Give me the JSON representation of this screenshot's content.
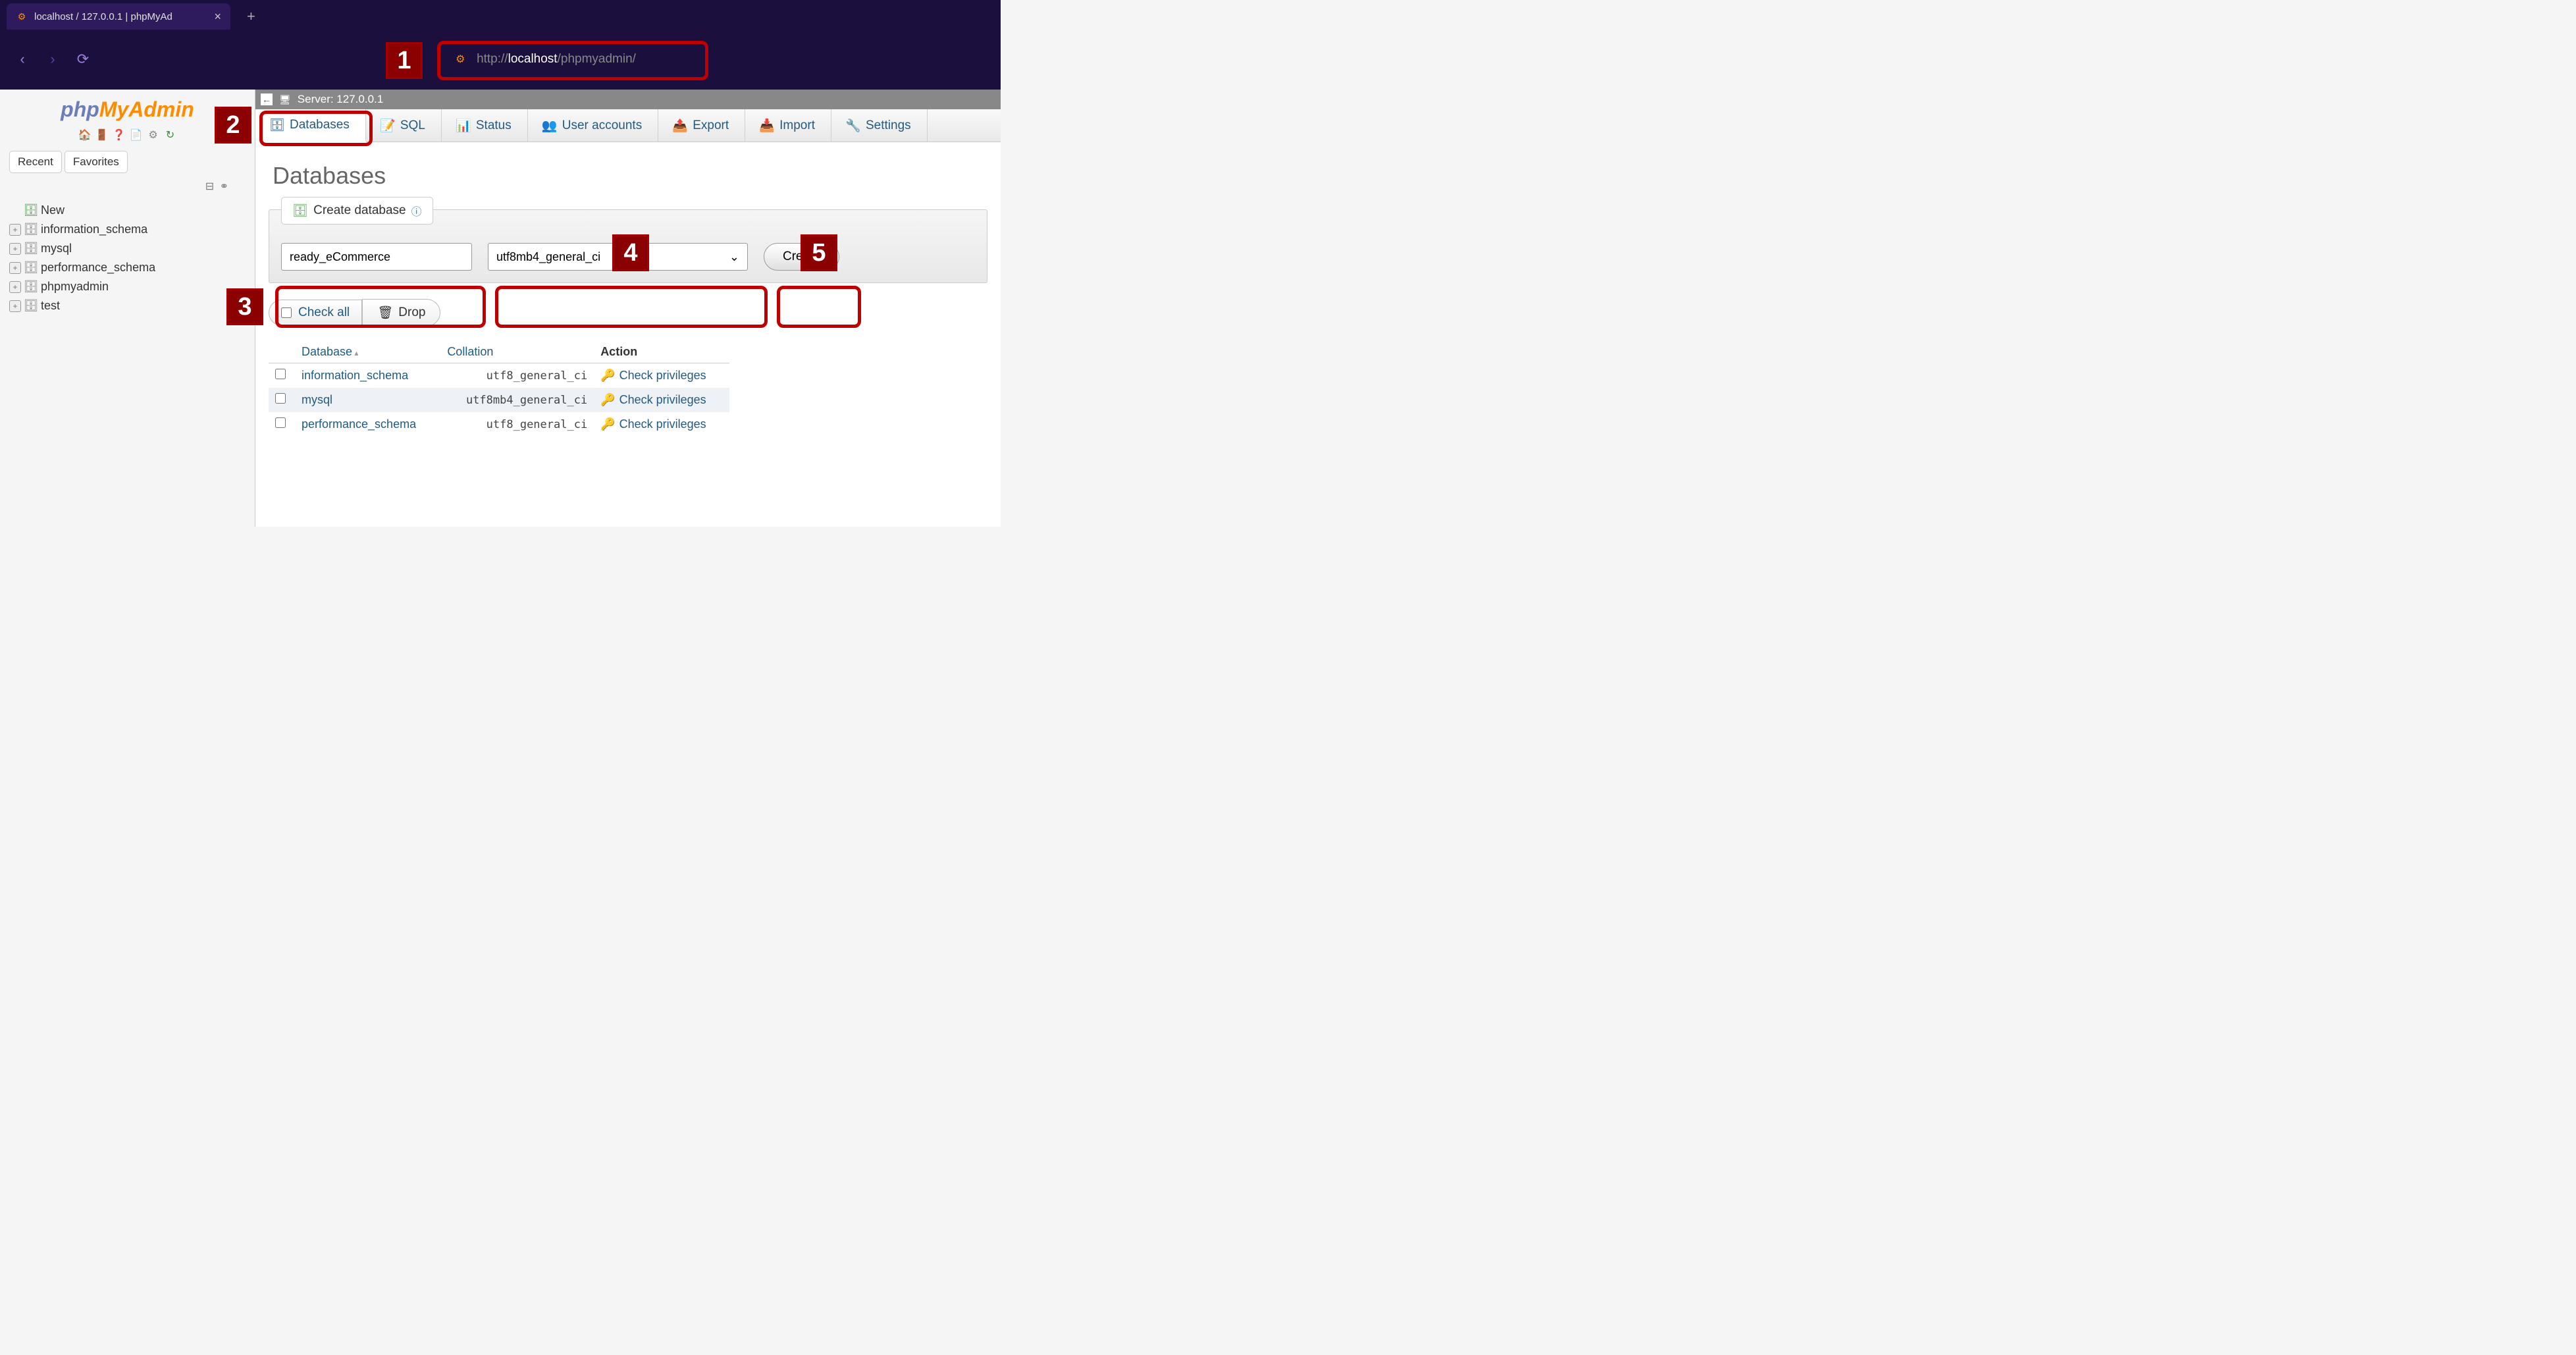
{
  "browser": {
    "tab_title": "localhost / 127.0.0.1 | phpMyAd",
    "url_prefix": "http://",
    "url_host": "localhost",
    "url_path": "/phpmyadmin/"
  },
  "logo": {
    "php": "php",
    "my": "MyAdmin"
  },
  "toolbar_icons": [
    "home-icon",
    "exit-icon",
    "help-icon",
    "doc-icon",
    "gear-icon",
    "refresh-icon"
  ],
  "side_tabs": {
    "recent": "Recent",
    "favorites": "Favorites"
  },
  "tree": {
    "new": "New",
    "items": [
      "information_schema",
      "mysql",
      "performance_schema",
      "phpmyadmin",
      "test"
    ]
  },
  "server_bar": {
    "label": "Server: 127.0.0.1"
  },
  "top_tabs": [
    {
      "label": "Databases",
      "icon": "database-icon",
      "active": true
    },
    {
      "label": "SQL",
      "icon": "sql-icon"
    },
    {
      "label": "Status",
      "icon": "status-icon"
    },
    {
      "label": "User accounts",
      "icon": "users-icon"
    },
    {
      "label": "Export",
      "icon": "export-icon"
    },
    {
      "label": "Import",
      "icon": "import-icon"
    },
    {
      "label": "Settings",
      "icon": "wrench-icon"
    }
  ],
  "page_title": "Databases",
  "create": {
    "legend": "Create database",
    "db_name": "ready_eCommerce",
    "collation": "utf8mb4_general_ci",
    "button": "Create"
  },
  "list_actions": {
    "check_all": "Check all",
    "drop": "Drop"
  },
  "table": {
    "headers": {
      "database": "Database",
      "collation": "Collation",
      "action": "Action"
    },
    "action_label": "Check privileges",
    "rows": [
      {
        "name": "information_schema",
        "collation": "utf8_general_ci"
      },
      {
        "name": "mysql",
        "collation": "utf8mb4_general_ci"
      },
      {
        "name": "performance_schema",
        "collation": "utf8_general_ci"
      }
    ]
  },
  "callouts": {
    "1": "1",
    "2": "2",
    "3": "3",
    "4": "4",
    "5": "5"
  }
}
